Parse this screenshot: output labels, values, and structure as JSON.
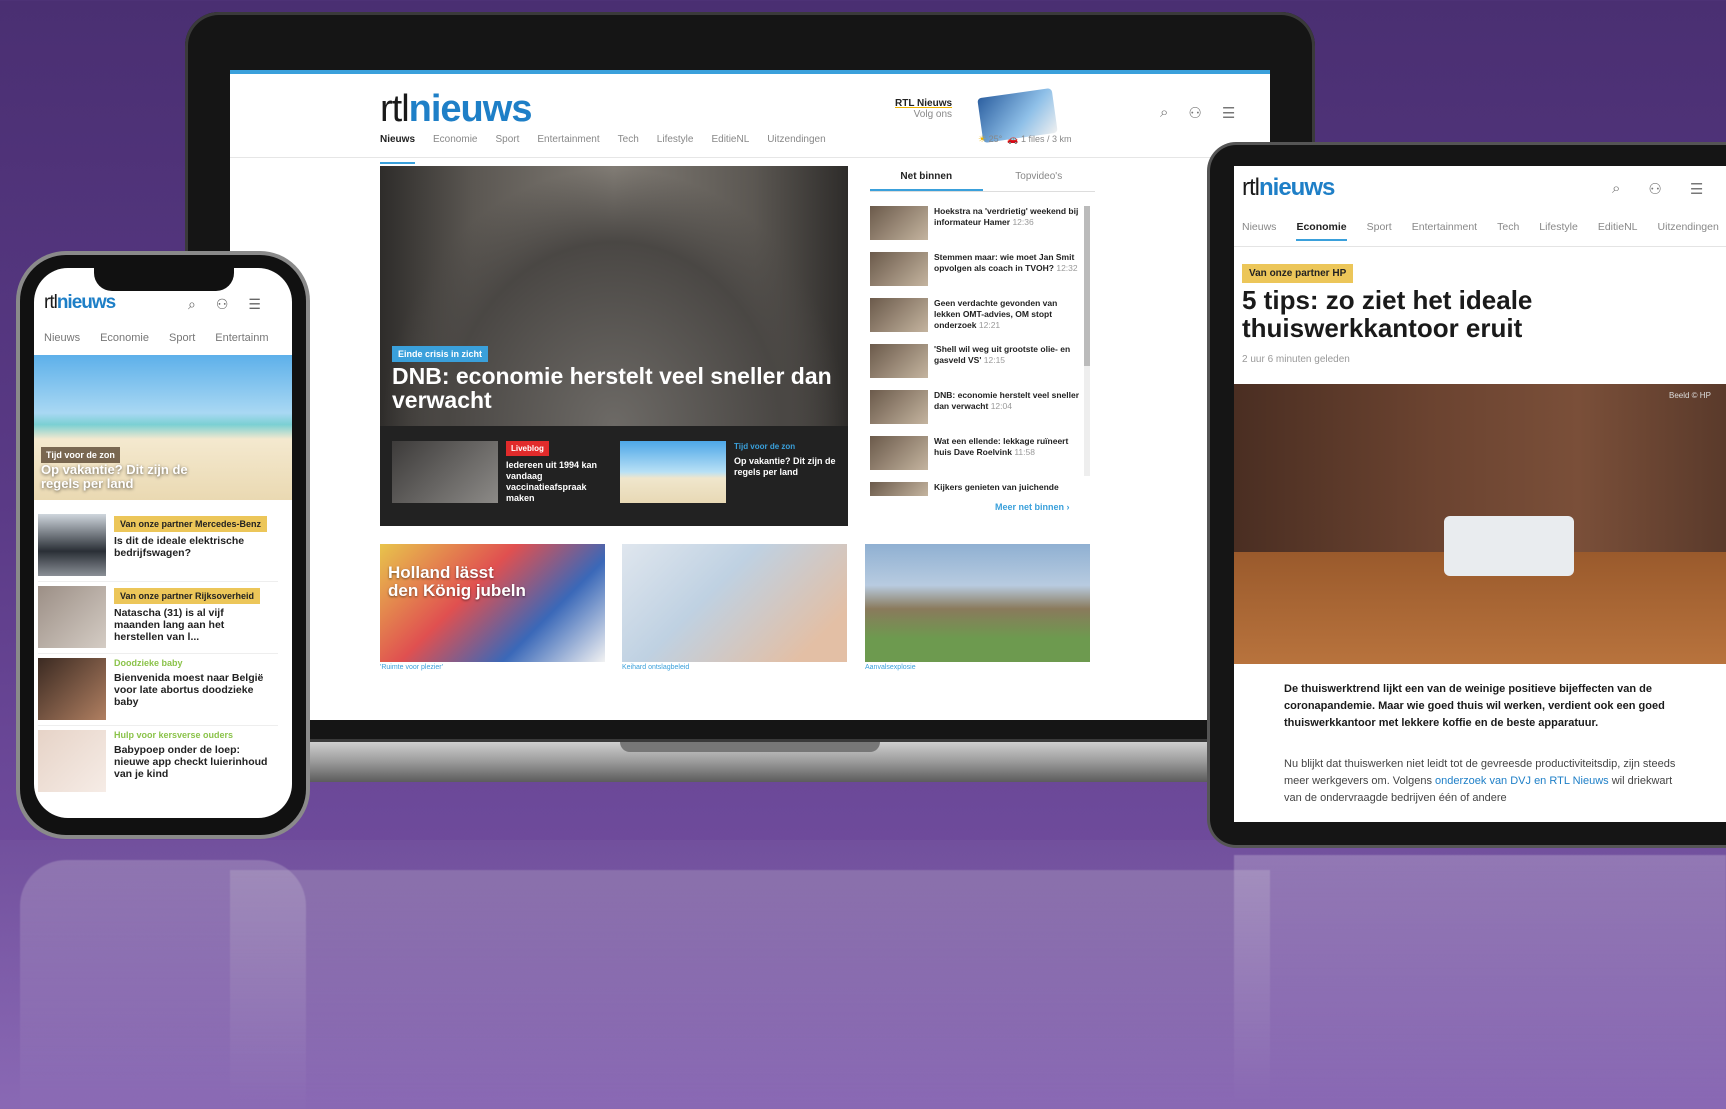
{
  "brand": {
    "rtl": "rtl",
    "nieuws": "nieuws"
  },
  "laptop": {
    "follow_name": "RTL Nieuws",
    "follow_sub": "Volg ons",
    "nav": [
      "Nieuws",
      "Economie",
      "Sport",
      "Entertainment",
      "Tech",
      "Lifestyle",
      "EditieNL",
      "Uitzendingen"
    ],
    "weather": "25°",
    "traffic": "1 files / 3 km",
    "hero": {
      "tag": "Einde crisis in zicht",
      "title": "DNB: economie herstelt veel sneller dan verwacht",
      "sub1_badge": "Liveblog",
      "sub1_title": "Iedereen uit 1994 kan vandaag vaccinatieafspraak maken",
      "sub2_tag": "Tijd voor de zon",
      "sub2_title": "Op vakantie? Dit zijn de regels per land"
    },
    "side": {
      "tabs": [
        "Net binnen",
        "Topvideo's"
      ],
      "items": [
        {
          "title": "Hoekstra na 'verdrietig' weekend bij informateur Hamer",
          "time": "12:36"
        },
        {
          "title": "Stemmen maar: wie moet Jan Smit opvolgen als coach in TVOH?",
          "time": "12:32"
        },
        {
          "title": "Geen verdachte gevonden van lekken OMT-advies, OM stopt onderzoek",
          "time": "12:21"
        },
        {
          "title": "'Shell wil weg uit grootste olie- en gasveld VS'",
          "time": "12:15"
        },
        {
          "title": "DNB: economie herstelt veel sneller dan verwacht",
          "time": "12:04"
        },
        {
          "title": "Wat een ellende: lekkage ruïneert huis Dave Roelvink",
          "time": "11:58"
        },
        {
          "title": "Kijkers genieten van juichende",
          "time": ""
        }
      ],
      "more": "Meer net binnen"
    },
    "cards": {
      "card1_title": "Holland lässt den König jubeln",
      "captions": [
        "'Ruimte voor plezier'",
        "Keihard ontslagbeleid",
        "Aanvalsexplosie"
      ]
    }
  },
  "phone": {
    "nav": [
      "Nieuws",
      "Economie",
      "Sport",
      "Entertainm"
    ],
    "hero_tag": "Tijd voor de zon",
    "hero_title": "Op vakantie? Dit zijn de regels per land",
    "items": [
      {
        "badge": "Van onze partner Mercedes-Benz",
        "title": "Is dit de ideale elektrische bedrijfswagen?"
      },
      {
        "badge": "Van onze partner Rijksoverheid",
        "title": "Natascha (31) is al vijf maanden lang aan het herstellen van l..."
      },
      {
        "tag": "Doodzieke baby",
        "title": "Bienvenida moest naar België voor late abortus doodzieke baby"
      },
      {
        "tag": "Hulp voor kersverse ouders",
        "title": "Babypoep onder de loep: nieuwe app checkt luierinhoud van je kind"
      }
    ]
  },
  "tablet": {
    "nav": [
      "Nieuws",
      "Economie",
      "Sport",
      "Entertainment",
      "Tech",
      "Lifestyle",
      "EditieNL",
      "Uitzendingen"
    ],
    "partner": "Van onze partner HP",
    "title": "5 tips: zo ziet het ideale thuiswerkkantoor eruit",
    "time": "2 uur 6 minuten geleden",
    "credit": "Beeld © HP",
    "lead": "De thuiswerktrend lijkt een van de weinige positieve bijeffecten van de coronapandemie. Maar wie goed thuis wil werken, verdient ook een goed thuiswerkkantoor met lekkere koffie en de beste apparatuur.",
    "body_start": "Nu blijkt dat thuiswerken niet leidt tot de gevreesde productiviteitsdip, zijn steeds meer werkgevers om. Volgens ",
    "body_link": "onderzoek van DVJ en RTL Nieuws",
    "body_end": " wil driekwart van de ondervraagde bedrijven één of andere"
  }
}
